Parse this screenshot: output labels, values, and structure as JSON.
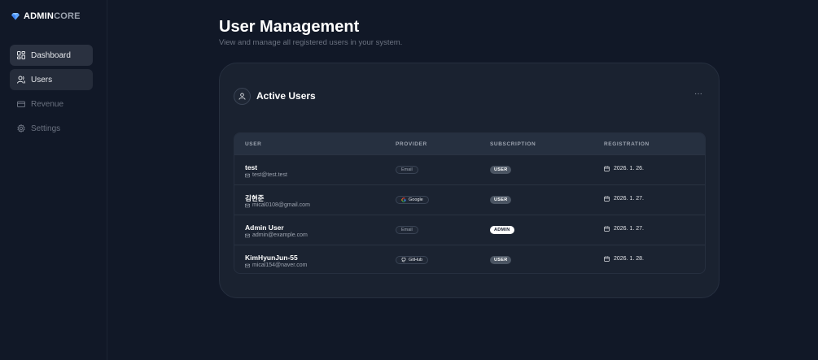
{
  "brand": {
    "name_bold": "ADMIN",
    "name_light": "CORE",
    "accent": "#3b82f6"
  },
  "sidebar": {
    "items": [
      {
        "label": "Dashboard",
        "icon": "grid-icon"
      },
      {
        "label": "Users",
        "icon": "users-icon"
      },
      {
        "label": "Revenue",
        "icon": "card-icon"
      },
      {
        "label": "Settings",
        "icon": "gear-icon"
      }
    ]
  },
  "header": {
    "title": "User Management",
    "subtitle": "View and manage all registered users in your system."
  },
  "card": {
    "title": "Active Users",
    "more_label": "···",
    "columns": [
      "USER",
      "PROVIDER",
      "SUBSCRIPTION",
      "REGISTRATION"
    ],
    "rows": [
      {
        "name": "test",
        "email": "test@test.test",
        "provider": "Email",
        "subscription": "USER",
        "registered": "2026. 1. 26."
      },
      {
        "name": "김현준",
        "email": "mical0108@gmail.com",
        "provider": "Google",
        "subscription": "USER",
        "registered": "2026. 1. 27."
      },
      {
        "name": "Admin User",
        "email": "admin@example.com",
        "provider": "Email",
        "subscription": "ADMIN",
        "registered": "2026. 1. 27."
      },
      {
        "name": "KimHyunJun-55",
        "email": "mical154@naver.com",
        "provider": "GitHub",
        "subscription": "USER",
        "registered": "2026. 1. 28."
      }
    ]
  }
}
